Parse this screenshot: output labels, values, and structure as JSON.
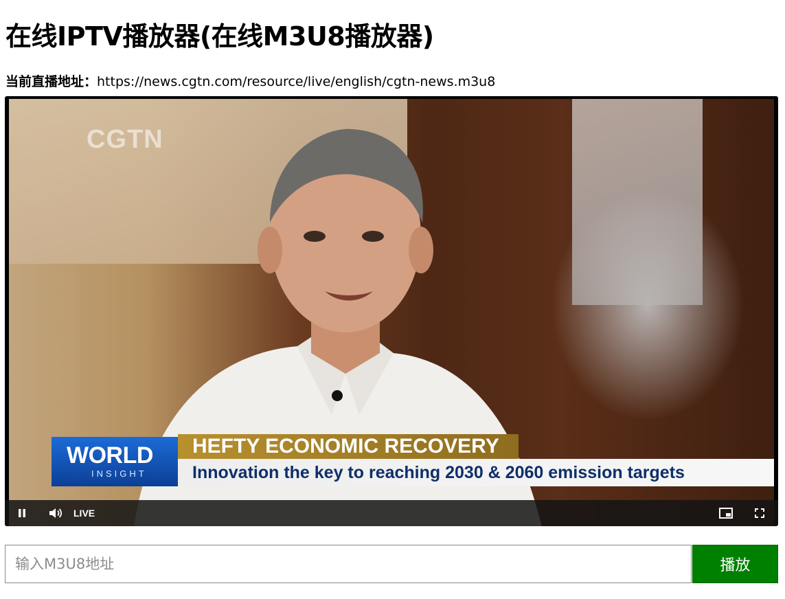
{
  "page": {
    "title": "在线IPTV播放器(在线M3U8播放器)"
  },
  "source": {
    "label": "当前直播地址：",
    "url": "https://news.cgtn.com/resource/live/english/cgtn-news.m3u8"
  },
  "video": {
    "channel_logo": "CGTN",
    "lower_third": {
      "brand_main": "WORLD",
      "brand_sub": "INSIGHT",
      "headline": "HEFTY ECONOMIC RECOVERY",
      "subline": "Innovation the key to reaching 2030 & 2060 emission targets"
    }
  },
  "controls": {
    "pause_icon": "pause-icon",
    "volume_icon": "volume-icon",
    "live_label": "LIVE",
    "pip_icon": "picture-in-picture-icon",
    "fullscreen_icon": "fullscreen-icon"
  },
  "form": {
    "input_placeholder": "输入M3U8地址",
    "input_value": "",
    "play_label": "播放"
  },
  "colors": {
    "play_button": "#008000",
    "control_bar": "#141414",
    "lower_third_blue": "#0c3f96",
    "lower_third_gold": "#b8902e",
    "subline_text": "#0e2f6a"
  }
}
